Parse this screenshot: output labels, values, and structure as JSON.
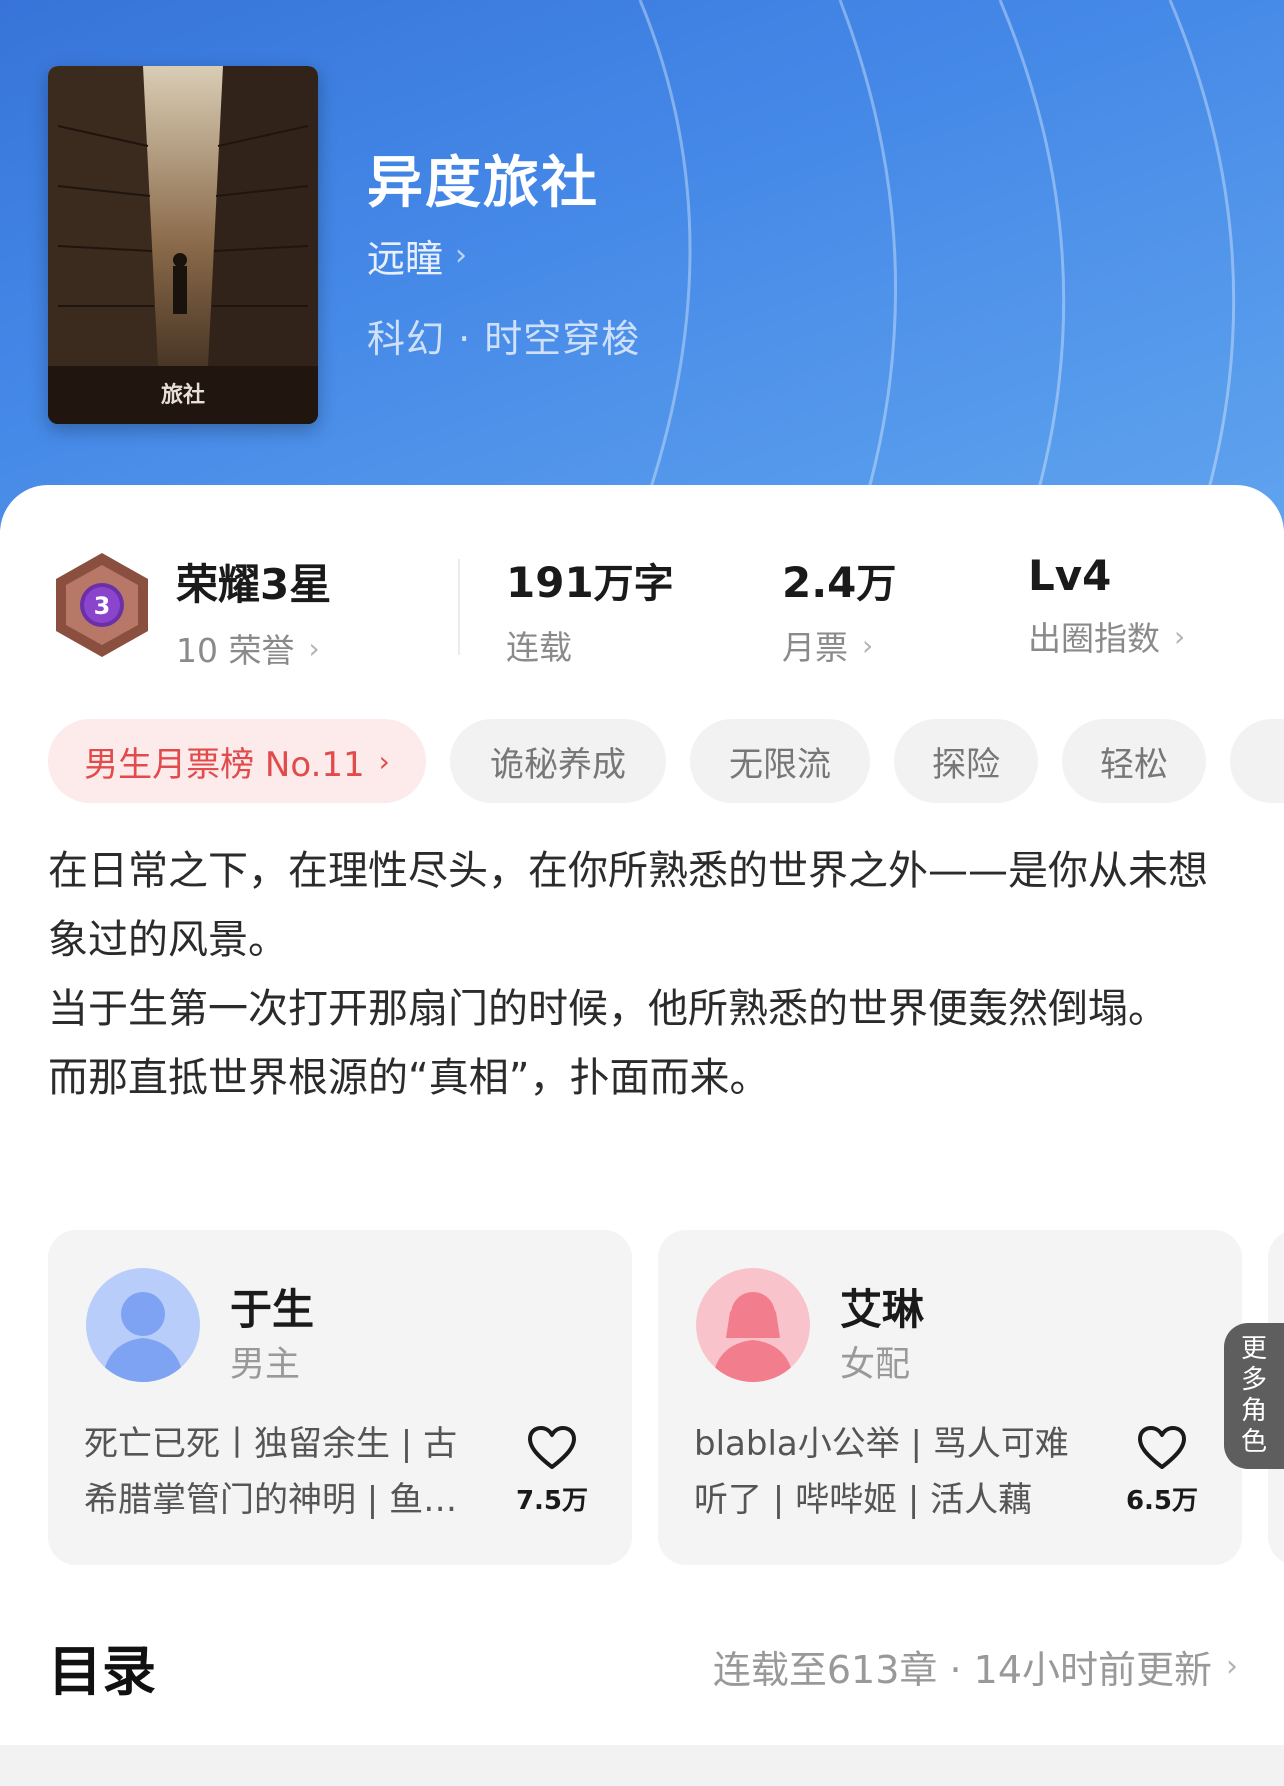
{
  "book": {
    "title": "异度旅社",
    "author": "远瞳",
    "genre": "科幻 · 时空穿梭",
    "cover_caption": "旅社"
  },
  "stats": {
    "honor": {
      "title": "荣耀3星",
      "badge_number": "3",
      "sub": "10 荣誉"
    },
    "words": {
      "value": "191",
      "unit": "万字",
      "label": "连载"
    },
    "monthly_tickets": {
      "value": "2.4",
      "unit": "万",
      "label": "月票"
    },
    "circle_index": {
      "value": "Lv4",
      "label": "出圈指数"
    }
  },
  "tags": [
    "男生月票榜 No.11",
    "诡秘养成",
    "无限流",
    "探险",
    "轻松"
  ],
  "synopsis": [
    "在日常之下，在理性尽头，在你所熟悉的世界之外——是你从未想象过的风景。",
    "当于生第一次打开那扇门的时候，他所熟悉的世界便轰然倒塌。",
    "而那直抵世界根源的“真相”，扑面而来。"
  ],
  "roles": [
    {
      "name": "于生",
      "type": "男主",
      "desc": "死亡已死丨独留余生 | 古希腊掌管门的神明 | 鱼生 | 打工人",
      "likes": "7.5万"
    },
    {
      "name": "艾琳",
      "type": "女配",
      "desc": "blabla小公举 | 骂人可难听了 | 哔哔姬 | 活人藕",
      "likes": "6.5万"
    }
  ],
  "more_roles_label": [
    "更",
    "多",
    "角",
    "色"
  ],
  "toc": {
    "title": "目录",
    "meta": "连载至613章 · 14小时前更新"
  },
  "colors": {
    "header_blue": "#3f86e8",
    "rank_red": "#e24b4b",
    "rank_bg": "#fdeaea",
    "male_avatar": "#7ea3f2",
    "female_avatar": "#f27d8c"
  }
}
